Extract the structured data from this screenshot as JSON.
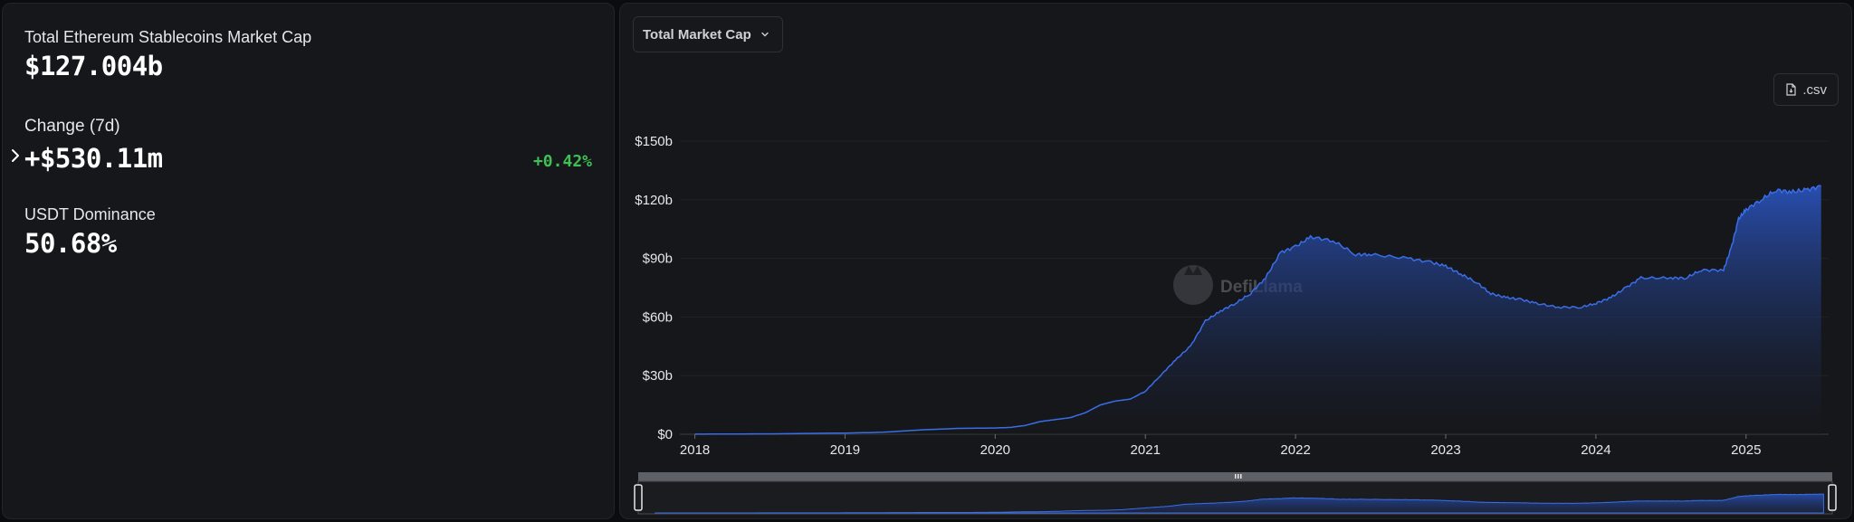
{
  "summary": {
    "market_cap_label": "Total Ethereum Stablecoins Market Cap",
    "market_cap_value": "$127.004b",
    "change_label": "Change (7d)",
    "change_value": "+$530.11m",
    "change_pct": "+0.42%",
    "dominance_label": "USDT Dominance",
    "dominance_value": "50.68%"
  },
  "controls": {
    "metric_select": "Total Market Cap",
    "csv_label": ".csv"
  },
  "watermark": "DefiLlama",
  "colors": {
    "series": "#3a6ee8",
    "positive": "#3fbf55",
    "panel": "#16171a"
  },
  "chart_data": {
    "type": "area",
    "title": "",
    "xlabel": "",
    "ylabel": "",
    "x_ticks": [
      "2018",
      "2019",
      "2020",
      "2021",
      "2022",
      "2023",
      "2024",
      "2025"
    ],
    "y_ticks": [
      "$0",
      "$30b",
      "$60b",
      "$90b",
      "$120b",
      "$150b"
    ],
    "xlim": [
      2017.9,
      2025.55
    ],
    "ylim": [
      0,
      150
    ],
    "grid": true,
    "legend": "none",
    "series": [
      {
        "values_unit": "billions USD",
        "points": [
          [
            2018.0,
            0.05
          ],
          [
            2018.5,
            0.2
          ],
          [
            2019.0,
            0.6
          ],
          [
            2019.25,
            1.0
          ],
          [
            2019.5,
            2.2
          ],
          [
            2019.75,
            3.0
          ],
          [
            2020.0,
            3.2
          ],
          [
            2020.1,
            3.5
          ],
          [
            2020.2,
            4.5
          ],
          [
            2020.3,
            6.5
          ],
          [
            2020.4,
            7.5
          ],
          [
            2020.5,
            8.5
          ],
          [
            2020.6,
            11.0
          ],
          [
            2020.7,
            15.0
          ],
          [
            2020.8,
            17.0
          ],
          [
            2020.9,
            18.0
          ],
          [
            2021.0,
            22.0
          ],
          [
            2021.1,
            30.0
          ],
          [
            2021.2,
            38.0
          ],
          [
            2021.3,
            45.0
          ],
          [
            2021.4,
            58.0
          ],
          [
            2021.5,
            63.0
          ],
          [
            2021.6,
            67.0
          ],
          [
            2021.7,
            72.0
          ],
          [
            2021.8,
            80.0
          ],
          [
            2021.9,
            93.0
          ],
          [
            2022.0,
            96.0
          ],
          [
            2022.1,
            101.0
          ],
          [
            2022.25,
            99.0
          ],
          [
            2022.4,
            92.0
          ],
          [
            2022.5,
            92.0
          ],
          [
            2022.75,
            90.0
          ],
          [
            2022.9,
            88.0
          ],
          [
            2023.0,
            86.0
          ],
          [
            2023.1,
            82.0
          ],
          [
            2023.2,
            78.0
          ],
          [
            2023.3,
            72.0
          ],
          [
            2023.4,
            70.0
          ],
          [
            2023.5,
            69.0
          ],
          [
            2023.6,
            67.0
          ],
          [
            2023.75,
            65.0
          ],
          [
            2023.9,
            65.0
          ],
          [
            2024.0,
            67.0
          ],
          [
            2024.1,
            70.0
          ],
          [
            2024.2,
            75.0
          ],
          [
            2024.3,
            80.0
          ],
          [
            2024.5,
            80.0
          ],
          [
            2024.6,
            80.0
          ],
          [
            2024.7,
            84.0
          ],
          [
            2024.85,
            84.0
          ],
          [
            2024.9,
            95.0
          ],
          [
            2024.95,
            110.0
          ],
          [
            2025.0,
            115.0
          ],
          [
            2025.1,
            120.0
          ],
          [
            2025.2,
            125.0
          ],
          [
            2025.3,
            124.0
          ],
          [
            2025.4,
            125.0
          ],
          [
            2025.5,
            127.0
          ]
        ]
      }
    ]
  }
}
